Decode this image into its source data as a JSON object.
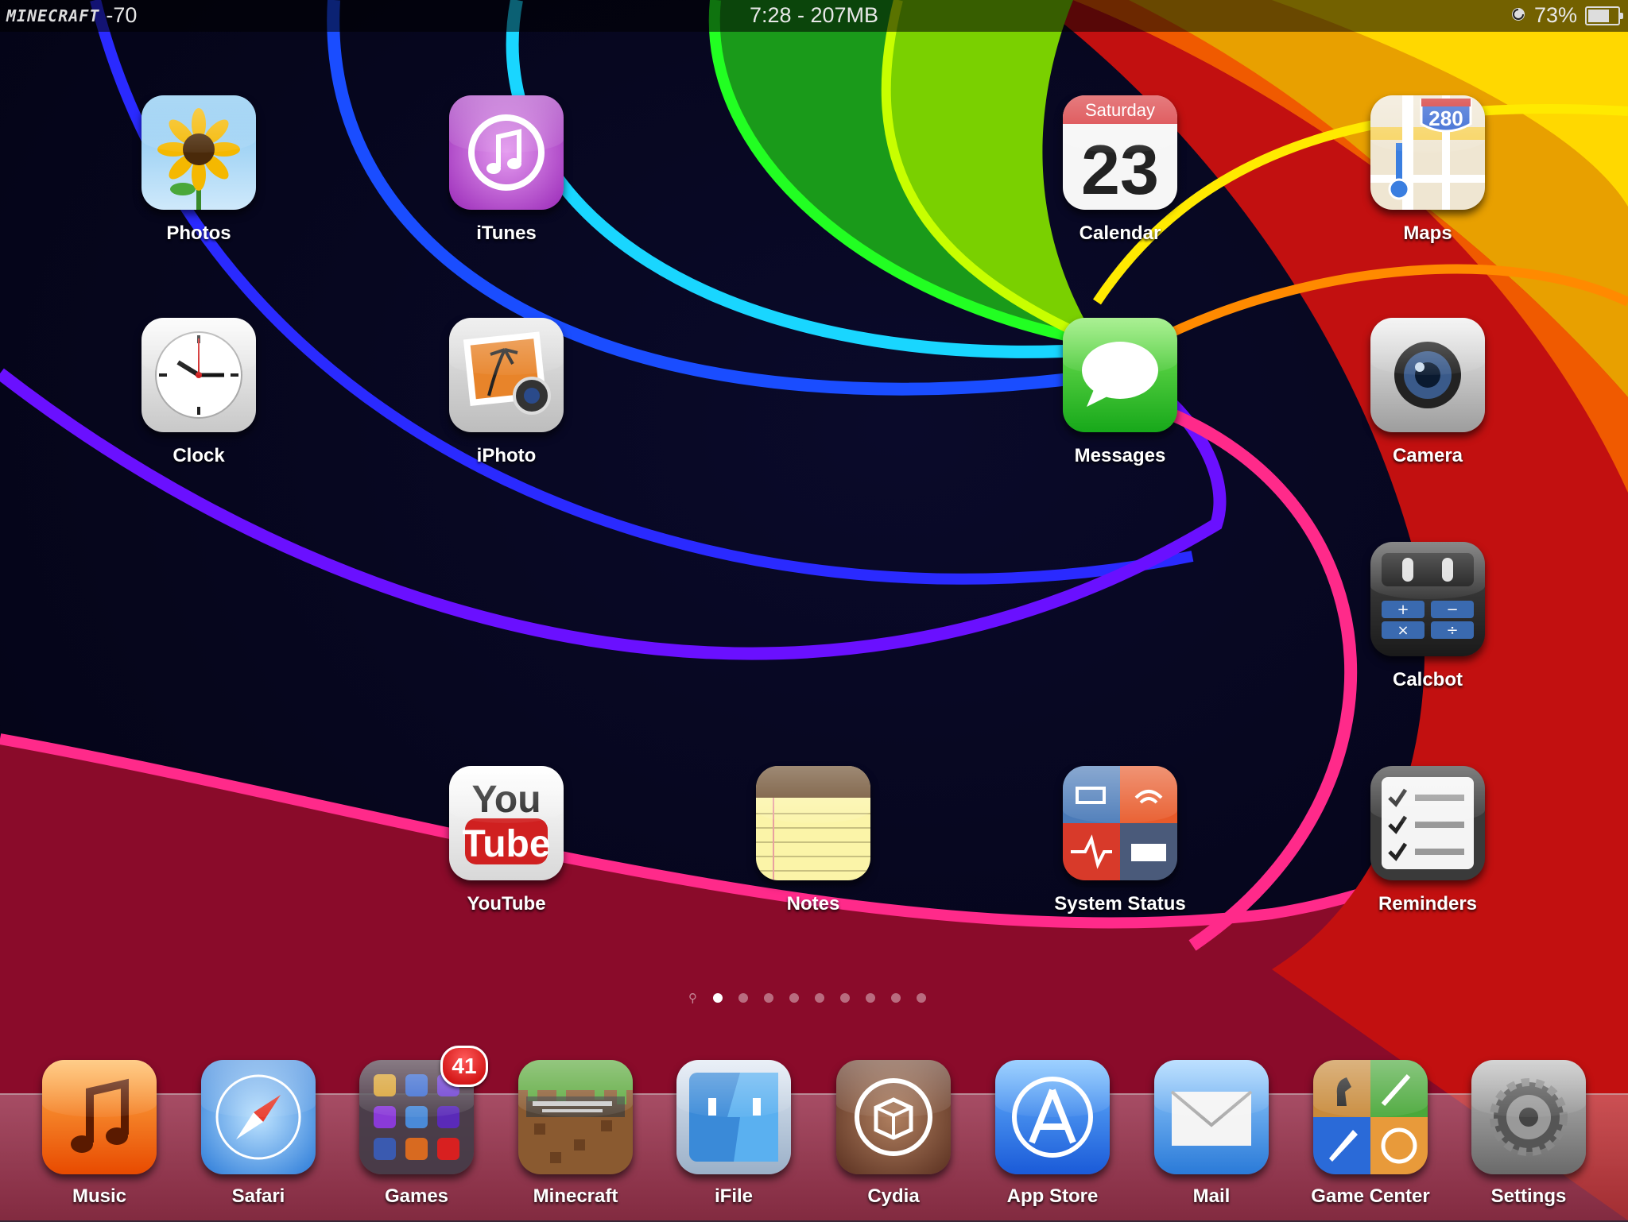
{
  "status_bar": {
    "carrier": "MINECRAFT",
    "signal": "-70",
    "time_memory": "7:28 - 207MB",
    "battery": "73%",
    "battery_level": 0.73
  },
  "home_apps": [
    {
      "id": "photos",
      "label": "Photos",
      "icon": "sunflower-icon"
    },
    {
      "id": "itunes",
      "label": "iTunes",
      "icon": "music-note-icon"
    },
    {
      "id": "calendar",
      "label": "Calendar",
      "icon": "calendar-icon",
      "day_name": "Saturday",
      "day_number": "23"
    },
    {
      "id": "maps",
      "label": "Maps",
      "icon": "map-icon",
      "road_sign": "280"
    },
    {
      "id": "clock",
      "label": "Clock",
      "icon": "clock-icon"
    },
    {
      "id": "iphoto",
      "label": "iPhoto",
      "icon": "photo-camera-icon"
    },
    {
      "id": "messages",
      "label": "Messages",
      "icon": "speech-bubble-icon"
    },
    {
      "id": "camera",
      "label": "Camera",
      "icon": "camera-lens-icon"
    },
    {
      "id": "calcbot",
      "label": "Calcbot",
      "icon": "calculator-icon",
      "keys": [
        "+",
        "−",
        "×",
        "÷"
      ]
    },
    {
      "id": "youtube",
      "label": "YouTube",
      "icon": "youtube-icon",
      "logo_top": "You",
      "logo_bottom": "Tube"
    },
    {
      "id": "notes",
      "label": "Notes",
      "icon": "notepad-icon"
    },
    {
      "id": "system_status",
      "label": "System Status",
      "icon": "system-status-icon"
    },
    {
      "id": "reminders",
      "label": "Reminders",
      "icon": "checklist-icon"
    }
  ],
  "page_indicator": {
    "pages": 9,
    "current": 1,
    "search_glyph": "⚲"
  },
  "dock_apps": [
    {
      "id": "music",
      "label": "Music",
      "icon": "music-note-icon"
    },
    {
      "id": "safari",
      "label": "Safari",
      "icon": "compass-icon"
    },
    {
      "id": "games",
      "label": "Games",
      "icon": "folder-icon",
      "badge": "41"
    },
    {
      "id": "minecraft",
      "label": "Minecraft",
      "icon": "minecraft-block-icon"
    },
    {
      "id": "ifile",
      "label": "iFile",
      "icon": "finder-face-icon"
    },
    {
      "id": "cydia",
      "label": "Cydia",
      "icon": "cydia-box-icon"
    },
    {
      "id": "app_store",
      "label": "App Store",
      "icon": "app-store-icon"
    },
    {
      "id": "mail",
      "label": "Mail",
      "icon": "envelope-icon"
    },
    {
      "id": "game_center",
      "label": "Game Center",
      "icon": "game-center-icon"
    },
    {
      "id": "settings",
      "label": "Settings",
      "icon": "gear-icon"
    }
  ]
}
